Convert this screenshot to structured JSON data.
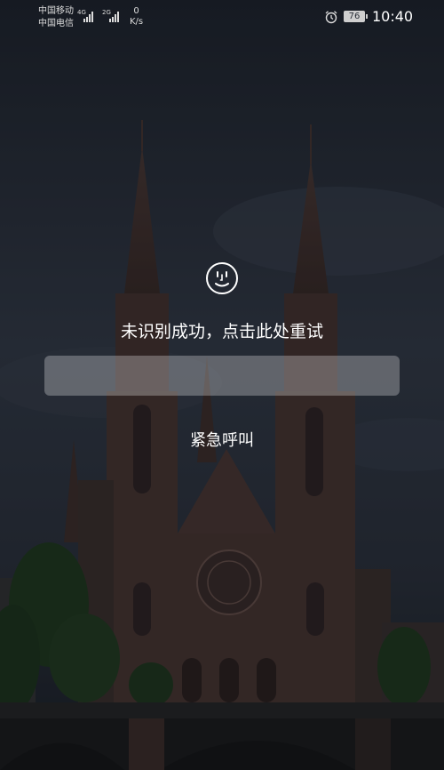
{
  "status_bar": {
    "carrier_1": "中国移动",
    "carrier_2": "中国电信",
    "network_1": "4G",
    "network_2": "2G",
    "speed_value": "0",
    "speed_unit": "K/s",
    "alarm_icon": "alarm-clock-icon",
    "battery": "76",
    "time": "10:40"
  },
  "lockscreen": {
    "face_icon": "face-unlock-icon",
    "message": "未识别成功，点击此处重试",
    "password_placeholder": "",
    "emergency_label": "紧急呼叫"
  },
  "wallpaper": {
    "subject": "twin-spire-cathedral",
    "sky_color": "#2c323d",
    "stone_color": "#4a3530"
  }
}
